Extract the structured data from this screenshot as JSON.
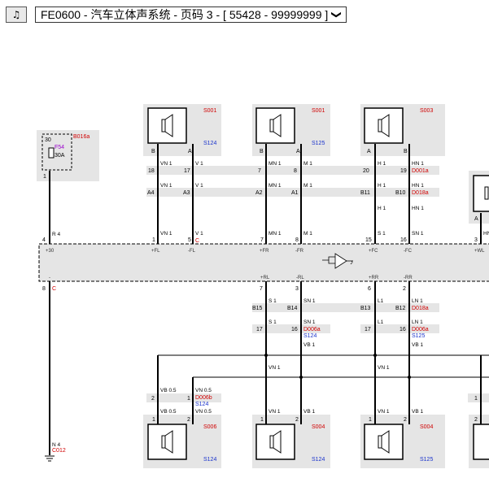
{
  "toolbar": {
    "icon_glyph": "♫",
    "icon_name": "audio-icon",
    "title": "FE0600 - 汽车立体声系统 - 页码 3 - [ 55428 - 99999999 ]",
    "dropdown_glyph": "❯"
  },
  "colors": {
    "wire_id": "#d00000",
    "splice": "#1a33cc",
    "fuse": "#9a00cc",
    "box": "#e5e5e5"
  },
  "fuse": {
    "block": "B016a",
    "pin_in": "30",
    "name": "F54",
    "rating": "30A",
    "pin_out": "1"
  },
  "speakers_top": {
    "fl": {
      "id": "S001",
      "splice": "S124",
      "pin_a": "A",
      "pin_b": "B"
    },
    "fr": {
      "id": "S001",
      "splice": "S125",
      "pin_a": "A",
      "pin_b": "B"
    },
    "fc": {
      "id": "S003",
      "pin_a": "A",
      "pin_b": "B"
    }
  },
  "speakers_bottom": {
    "rl_a": {
      "id": "S006",
      "splice": "S124",
      "pin1": "1",
      "pin2": "2"
    },
    "rl_b": {
      "id": "S004",
      "splice": "S124",
      "pin1": "1",
      "pin2": "2"
    },
    "rr_a": {
      "id": "S004",
      "splice": "S125",
      "pin1": "1",
      "pin2": "2"
    }
  },
  "connectors": {
    "d001a": "D001a",
    "d018a": "D018a",
    "d018a_low": "D018a",
    "d006a_l": "D006a",
    "d006a_r": "D006a",
    "d006b": "D006b",
    "c": "C",
    "c_ground": "C",
    "ground": "C012"
  },
  "amp": {
    "pins_top": [
      "4",
      "1",
      "5",
      "7",
      "8",
      "15",
      "16",
      "3"
    ],
    "labels_top": [
      "+30",
      "+FL",
      "-FL",
      "+FR",
      "-FR",
      "+FC",
      "-FC",
      "+WL"
    ],
    "pins_bottom": [
      "8",
      "7",
      "3",
      "6",
      "2"
    ],
    "labels_bottom": [
      "-",
      "+RL",
      "-RL",
      "+RR",
      "-RR"
    ]
  },
  "wires": {
    "r4": "R 4",
    "vn1": "VN 1",
    "v1": "V 1",
    "mn1": "MN 1",
    "m1": "M 1",
    "h1": "H 1",
    "hn1": "HN 1",
    "sn1": "SN 1",
    "hn": "HN",
    "s1": "S 1",
    "l1": "L1",
    "ln1": "LN 1",
    "vb1": "VB 1",
    "vb05": "VB 0.5",
    "vn05": "VN 0.5",
    "n4": "N 4"
  },
  "inline": {
    "row1": [
      "18",
      "17",
      "7",
      "8",
      "20",
      "19"
    ],
    "row2": [
      "A4",
      "A3",
      "A2",
      "A1",
      "B11",
      "B10"
    ],
    "row3": [
      "B15",
      "B14",
      "B13",
      "B12"
    ],
    "row4": [
      "17",
      "16",
      "17",
      "16"
    ],
    "row5": [
      "2",
      "1"
    ],
    "partial": [
      "A",
      "1",
      "2"
    ]
  }
}
